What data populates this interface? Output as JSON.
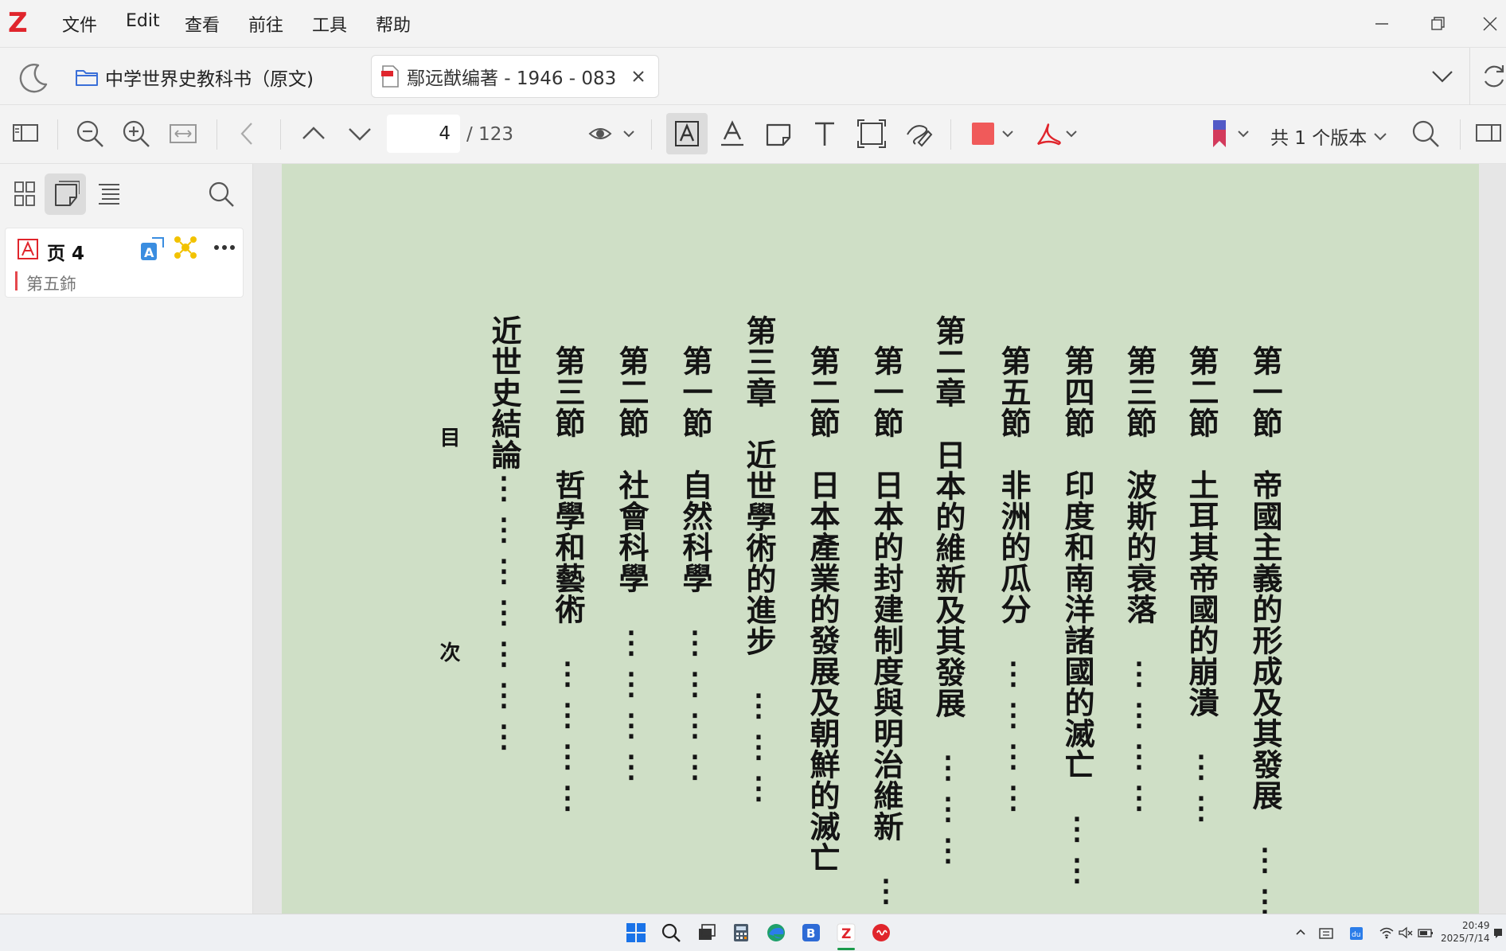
{
  "app": {
    "logo": "Z"
  },
  "menu": [
    "文件",
    "Edit",
    "查看",
    "前往",
    "工具",
    "帮助"
  ],
  "tabs": {
    "folder_label": "中学世界史教科书（原文)",
    "doc_label": "鄢远猷编著 - 1946 - 083"
  },
  "toolbar": {
    "page_current": "4",
    "page_total": "/ 123",
    "versions_label": "共 1 个版本",
    "highlight_color": "#f05a5a"
  },
  "sidebar": {
    "annotation": {
      "page_label": "页 4",
      "text": "第五鉓",
      "bar_color": "#e5484d"
    }
  },
  "document": {
    "columns": [
      {
        "text": "第一節",
        "body": "帝國主義的形成及其發展",
        "dots": "⋮⋮"
      },
      {
        "text": "第二節",
        "body": "土耳其帝國的崩潰",
        "dots": "⋮⋮"
      },
      {
        "text": "第三節",
        "body": "波斯的衰落",
        "dots": "⋮⋮⋮⋮"
      },
      {
        "text": "第四節",
        "body": "印度和南洋諸國的滅亡",
        "dots": "⋮⋮"
      },
      {
        "text": "第五節",
        "body": "非洲的瓜分",
        "dots": "⋮⋮⋮⋮"
      },
      {
        "text": "第二章",
        "body": "日本的維新及其發展",
        "dots": "⋮⋮⋮"
      },
      {
        "text": "第一節",
        "body": "日本的封建制度與明治維新",
        "dots": "⋮"
      },
      {
        "text": "第二節",
        "body": "日本產業的發展及朝鮮的滅亡",
        "dots": ""
      },
      {
        "text": "第三章",
        "body": "近世學術的進步",
        "dots": "⋮⋮⋮"
      },
      {
        "text": "第一節",
        "body": "自然科學",
        "dots": "⋮⋮⋮⋮"
      },
      {
        "text": "第二節",
        "body": "社會科學",
        "dots": "⋮⋮⋮⋮"
      },
      {
        "text": "第三節",
        "body": "哲學和藝術",
        "dots": "⋮⋮⋮⋮"
      },
      {
        "text": "近世史結論",
        "body": "",
        "dots": "⋮⋮⋮⋮⋮⋮⋮"
      }
    ],
    "heading_top": "目",
    "heading_bottom": "次"
  },
  "taskbar": {
    "clock_time": "20:49",
    "clock_date": "2025/7/14"
  }
}
